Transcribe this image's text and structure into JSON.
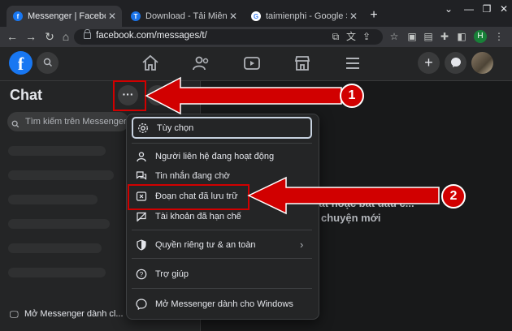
{
  "browser": {
    "tabs": [
      {
        "title": "Messenger | Facebook",
        "favicon": "facebook-icon",
        "color": "#1877f2"
      },
      {
        "title": "Download - Tải Miễn Phí VN",
        "favicon": "taimienphi-icon",
        "color": "#1a73e8"
      },
      {
        "title": "taimienphi - Google Search",
        "favicon": "google-icon",
        "color": "#ffffff"
      }
    ],
    "url": "facebook.com/messages/t/",
    "profile_initial": "H"
  },
  "sidebar": {
    "title": "Chat",
    "more_label": "···",
    "search_placeholder": "Tìm kiếm trên Messenger",
    "footer_link": "Mở Messenger dành cl..."
  },
  "main": {
    "line1": "...n chat hoặc bắt đầu c...",
    "line2": "chuyện mới"
  },
  "menu": {
    "items": [
      {
        "label": "Tùy chọn",
        "icon": "gear-icon"
      },
      {
        "label": "Người liên hệ đang hoạt động",
        "icon": "contacts-icon"
      },
      {
        "label": "Tin nhắn đang chờ",
        "icon": "chat-bubbles-icon"
      },
      {
        "label": "Đoạn chat đã lưu trữ",
        "icon": "archive-icon"
      },
      {
        "label": "Tài khoản đã hạn chế",
        "icon": "restricted-icon"
      },
      {
        "label": "Quyền riêng tư & an toàn",
        "icon": "shield-icon"
      },
      {
        "label": "Trợ giúp",
        "icon": "help-icon"
      },
      {
        "label": "Mở Messenger dành cho Windows",
        "icon": "messenger-icon"
      }
    ]
  },
  "annotations": {
    "step1": "1",
    "step2": "2",
    "color": "#d10000"
  }
}
